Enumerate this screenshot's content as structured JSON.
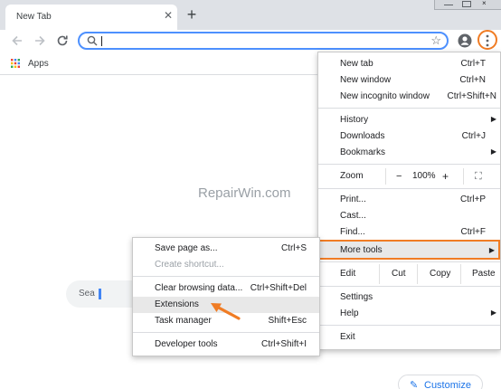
{
  "tab": {
    "title": "New Tab",
    "close": "✕",
    "new_tab": "+"
  },
  "toolbar": {
    "star": "☆"
  },
  "bookmarks": {
    "apps_label": "Apps"
  },
  "page": {
    "watermark": "RepairWin.com",
    "search_placeholder": "Sea",
    "customize_label": "Customize",
    "customize_icon": "✎"
  },
  "menu": {
    "items": [
      {
        "label": "New tab",
        "shortcut": "Ctrl+T"
      },
      {
        "label": "New window",
        "shortcut": "Ctrl+N"
      },
      {
        "label": "New incognito window",
        "shortcut": "Ctrl+Shift+N"
      },
      {
        "label": "History",
        "arrow": "▶"
      },
      {
        "label": "Downloads",
        "shortcut": "Ctrl+J"
      },
      {
        "label": "Bookmarks",
        "arrow": "▶"
      },
      {
        "label": "Print...",
        "shortcut": "Ctrl+P"
      },
      {
        "label": "Cast..."
      },
      {
        "label": "Find...",
        "shortcut": "Ctrl+F"
      },
      {
        "label": "More tools",
        "arrow": "▶"
      },
      {
        "label": "Settings"
      },
      {
        "label": "Help",
        "arrow": "▶"
      },
      {
        "label": "Exit"
      }
    ],
    "zoom": {
      "label": "Zoom",
      "minus": "−",
      "value": "100%",
      "plus": "+",
      "fullscreen": "⛶"
    },
    "edit": {
      "label": "Edit",
      "cut": "Cut",
      "copy": "Copy",
      "paste": "Paste"
    }
  },
  "submenu": {
    "items": [
      {
        "label": "Save page as...",
        "shortcut": "Ctrl+S"
      },
      {
        "label": "Create shortcut...",
        "shortcut": ""
      },
      {
        "label": "Clear browsing data...",
        "shortcut": "Ctrl+Shift+Del"
      },
      {
        "label": "Extensions",
        "shortcut": ""
      },
      {
        "label": "Task manager",
        "shortcut": "Shift+Esc"
      },
      {
        "label": "Developer tools",
        "shortcut": "Ctrl+Shift+I"
      }
    ]
  },
  "colors": {
    "accent": "#f07c24",
    "omnibox_border": "#4d90fe",
    "customize": "#1a73e8"
  }
}
